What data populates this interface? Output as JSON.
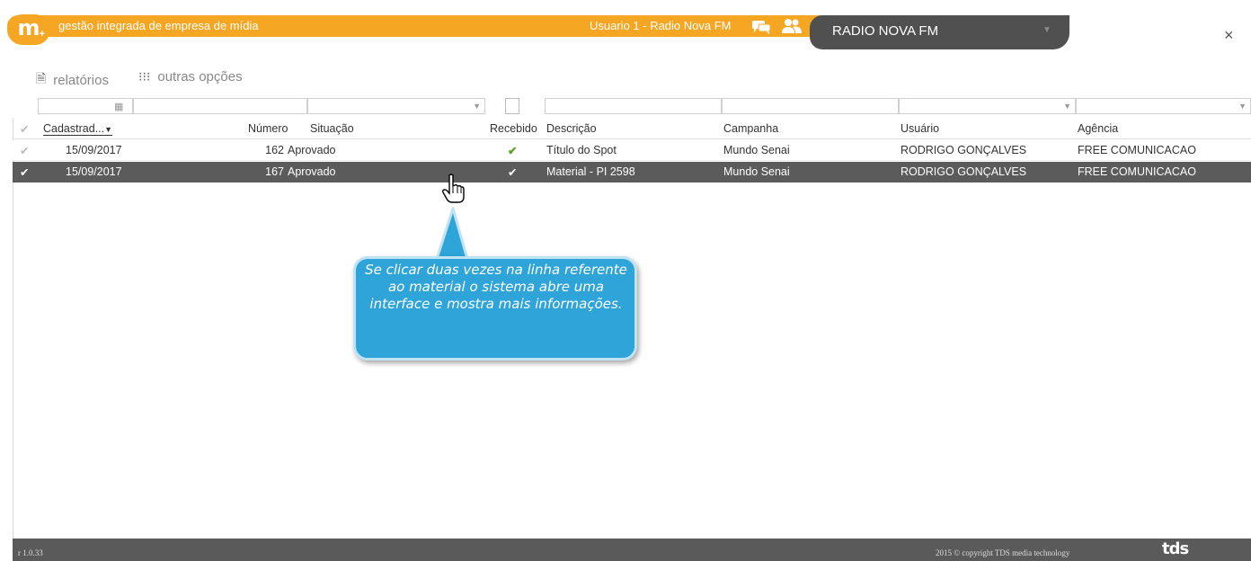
{
  "header": {
    "logo_text": "m",
    "logo_plus": "+",
    "app_title": "gestão integrada de empresa de mídia",
    "user_label": "Usuario 1 - Radio Nova FM",
    "station_name": "RADIO NOVA FM",
    "close_symbol": "×",
    "colors": {
      "accent": "#f5a623",
      "station_bg": "#505050"
    }
  },
  "toolbar": {
    "reports_label": "relatórios",
    "more_options_label": "outras opções"
  },
  "grid": {
    "columns": [
      "Cadastrad...",
      "Número",
      "Situação",
      "Recebido",
      "Descrição",
      "Campanha",
      "Usuário",
      "Agência"
    ],
    "rows": [
      {
        "cadastro": "15/09/2017",
        "numero": "162",
        "situacao": "Aprovado",
        "descricao": "Título do Spot",
        "campanha": "Mundo Senai",
        "usuario": "RODRIGO GONÇALVES",
        "agencia": "FREE COMUNICACAO",
        "selected": false
      },
      {
        "cadastro": "15/09/2017",
        "numero": "167",
        "situacao": "Aprovado",
        "descricao": "Material - PI 2598",
        "campanha": "Mundo Senai",
        "usuario": "RODRIGO GONÇALVES",
        "agencia": "FREE COMUNICACAO",
        "selected": true
      }
    ],
    "colors": {
      "selected_row": "#5b5b5b",
      "received_check": "#5aa020"
    }
  },
  "callout": {
    "text": "Se clicar duas vezes na linha referente ao material o sistema abre uma interface e mostra mais informações.",
    "color": "#2ea4d8"
  },
  "footer": {
    "version": "r 1.0.33",
    "copyright": "2015 © copyright TDS media technology",
    "logo_text": "tds"
  }
}
